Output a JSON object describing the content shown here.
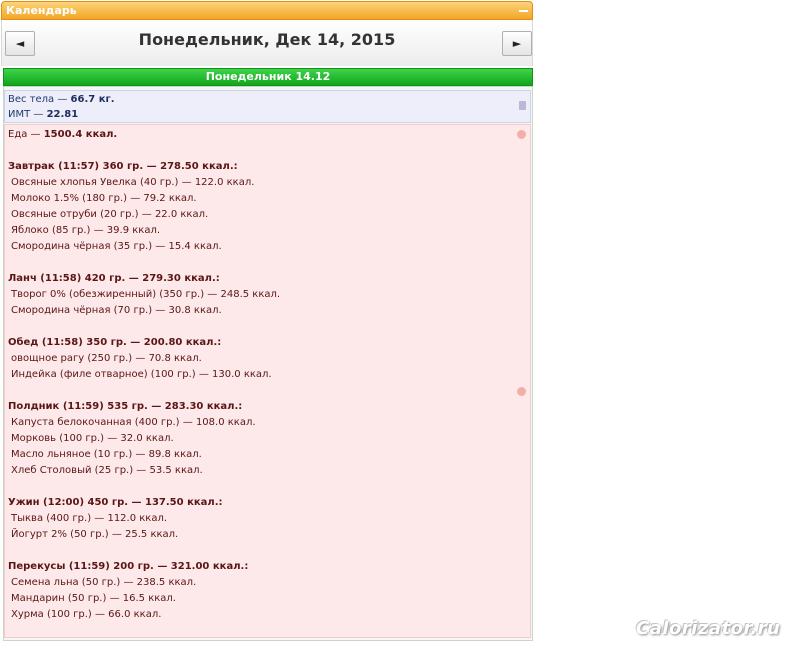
{
  "panel": {
    "title": "Календарь"
  },
  "nav": {
    "prev_label": "◄",
    "next_label": "►",
    "date_title": "Понедельник, Дек 14, 2015"
  },
  "day": {
    "label": "Понедельник 14.12"
  },
  "body": {
    "weight_label": "Вес тела — ",
    "weight_value": "66.7 кг.",
    "bmi_label": "ИМТ — ",
    "bmi_value": "22.81"
  },
  "food": {
    "total_label": "Еда — ",
    "total_value": "1500.4 ккал.",
    "meals": [
      {
        "header": "Завтрак (11:57) 360 гр. — 278.50 ккал.:",
        "items": [
          "Овсяные хлопья Увелка (40 гр.) — 122.0 ккал.",
          "Молоко 1.5% (180 гр.) — 79.2 ккал.",
          "Овсяные отруби (20 гр.) — 22.0 ккал.",
          "Яблоко (85 гр.) — 39.9 ккал.",
          "Смородина чёрная (35 гр.) — 15.4 ккал."
        ]
      },
      {
        "header": "Ланч (11:58) 420 гр. — 279.30 ккал.:",
        "items": [
          "Творог 0% (обезжиренный) (350 гр.) — 248.5 ккал.",
          "Смородина чёрная (70 гр.) — 30.8 ккал."
        ]
      },
      {
        "header": "Обед (11:58) 350 гр. — 200.80 ккал.:",
        "items": [
          "овощное рагу (250 гр.) — 70.8 ккал.",
          "Индейка (филе отварное) (100 гр.) — 130.0 ккал."
        ]
      },
      {
        "header": "Полдник (11:59) 535 гр. — 283.30 ккал.:",
        "items": [
          "Капуста белокочанная (400 гр.) — 108.0 ккал.",
          "Морковь (100 гр.) — 32.0 ккал.",
          "Масло льняное (10 гр.) — 89.8 ккал.",
          "Хлеб Столовый (25 гр.) — 53.5 ккал."
        ]
      },
      {
        "header": "Ужин (12:00) 450 гр. — 137.50 ккал.:",
        "items": [
          "Тыква (400 гр.) — 112.0 ккал.",
          "Йогурт 2% (50 гр.) — 25.5 ккал."
        ]
      },
      {
        "header": "Перекусы (11:59) 200 гр. — 321.00 ккал.:",
        "items": [
          "Семена льна (50 гр.) — 238.5 ккал.",
          "Мандарин (50 гр.) — 16.5 ккал.",
          "Хурма (100 гр.) — 66.0 ккал."
        ]
      }
    ]
  },
  "watermark": "Calorizator.ru",
  "icons": {
    "collapse": "minus-icon",
    "weight": "scale-icon",
    "food": "apple-icon"
  }
}
